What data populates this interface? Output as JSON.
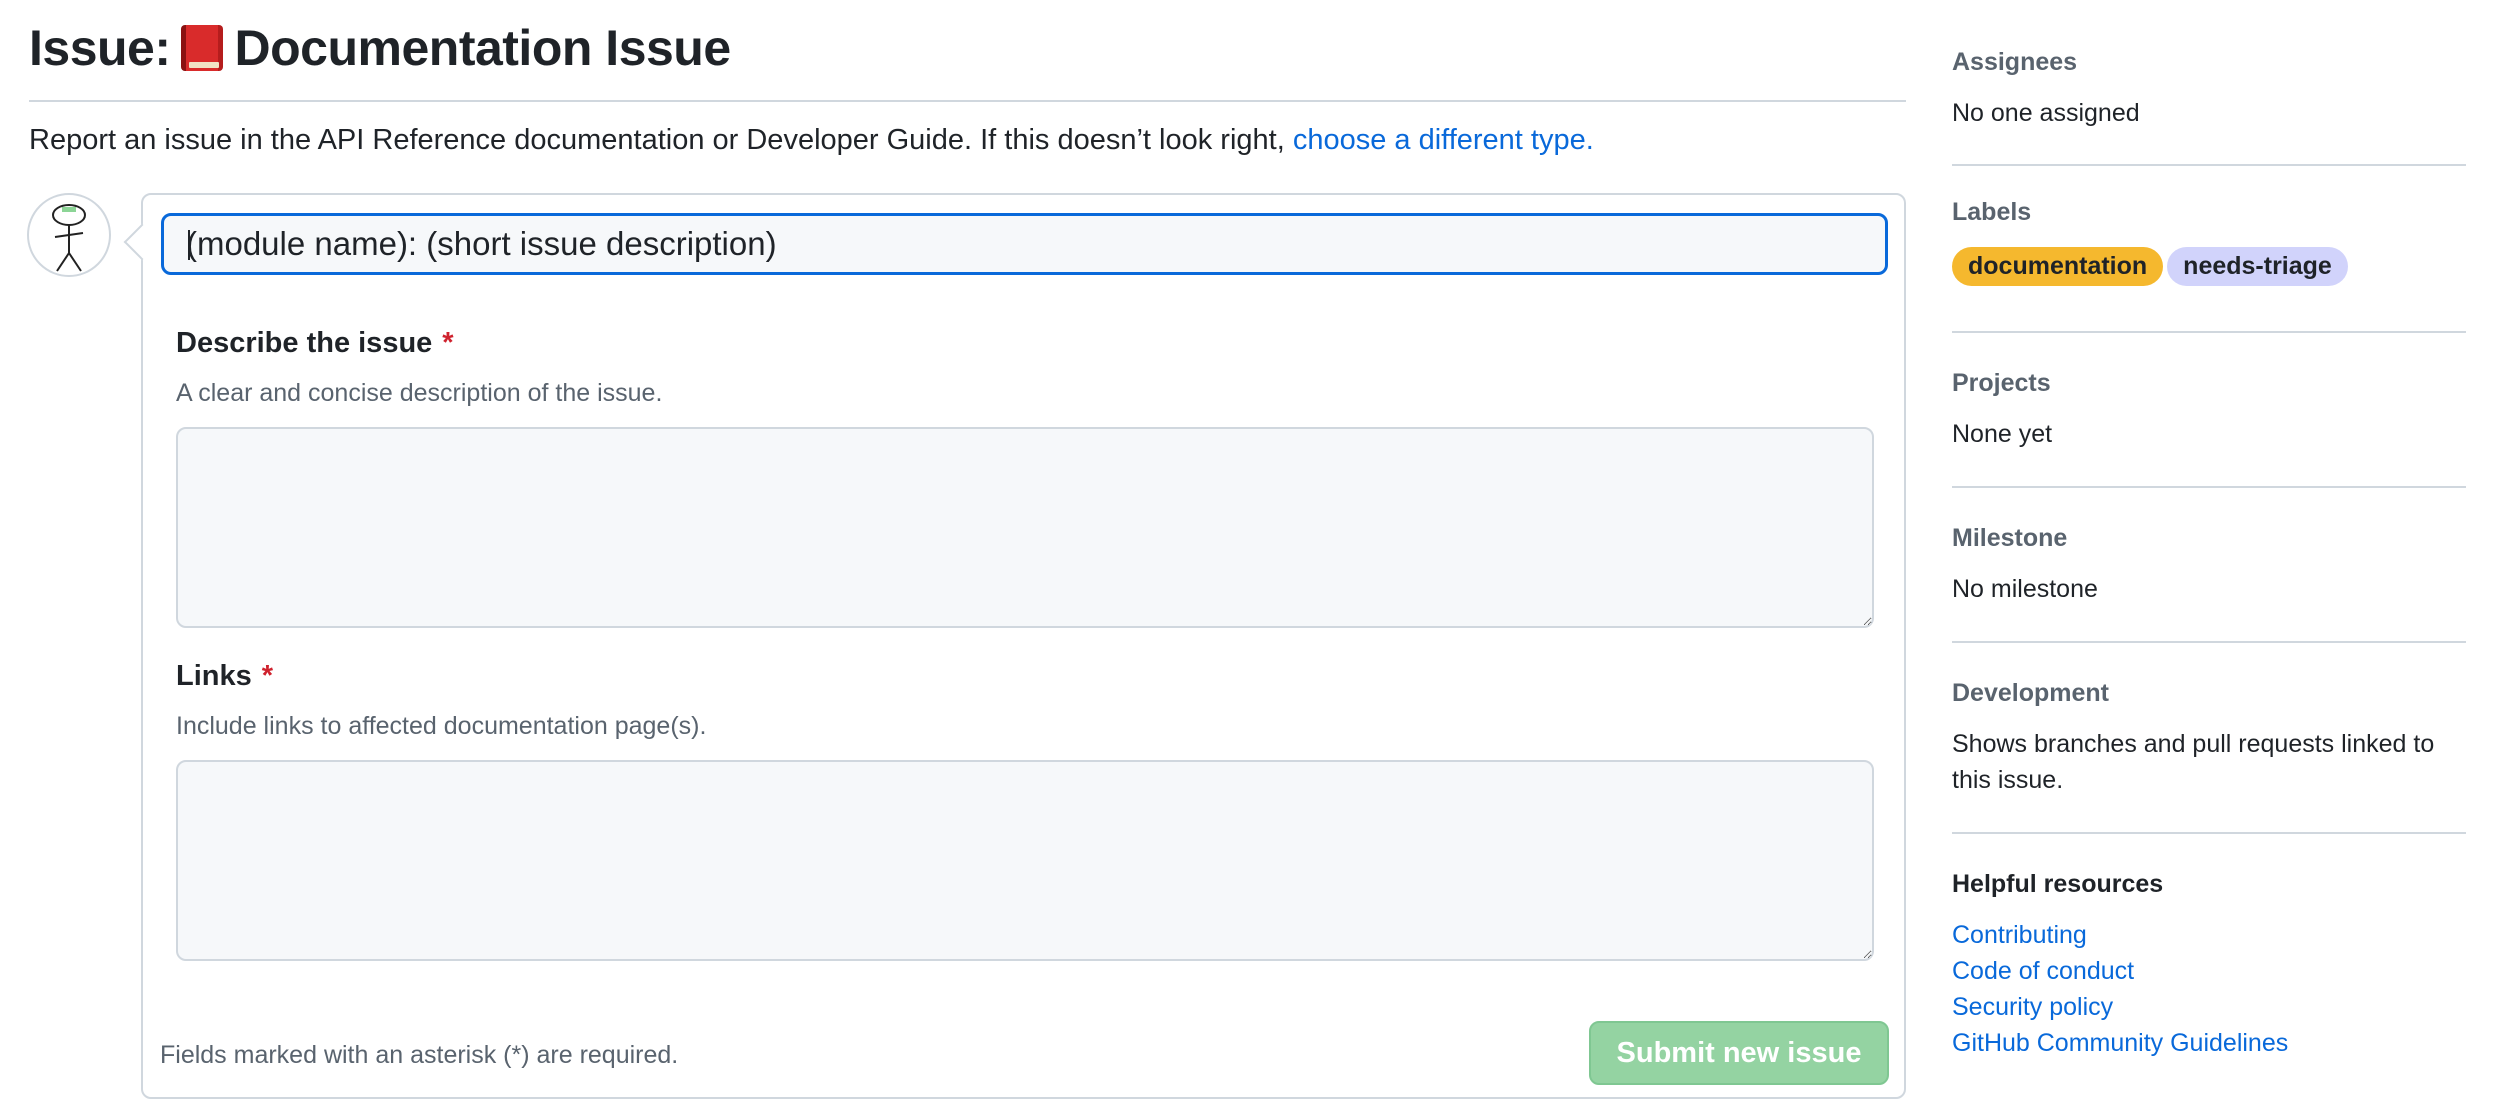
{
  "header": {
    "title_prefix": "Issue:",
    "title_text": "Documentation Issue",
    "intro_text": "Report an issue in the API Reference documentation or Developer Guide. If this doesn’t look right,",
    "intro_link": "choose a different type."
  },
  "form": {
    "title_placeholder": "(module name): (short issue description)",
    "fields": [
      {
        "label": "Describe the issue",
        "required_mark": "*",
        "description": "A clear and concise description of the issue."
      },
      {
        "label": "Links",
        "required_mark": "*",
        "description": "Include links to affected documentation page(s)."
      }
    ],
    "footer_note": "Fields marked with an asterisk (*) are required.",
    "submit_label": "Submit new issue",
    "submit_enabled": false
  },
  "sidebar": {
    "assignees": {
      "heading": "Assignees",
      "value": "No one assigned"
    },
    "labels": {
      "heading": "Labels",
      "items": [
        {
          "name": "documentation",
          "color": "#f5b82e"
        },
        {
          "name": "needs-triage",
          "color": "#d1d3fb"
        }
      ]
    },
    "projects": {
      "heading": "Projects",
      "value": "None yet"
    },
    "milestone": {
      "heading": "Milestone",
      "value": "No milestone"
    },
    "development": {
      "heading": "Development",
      "value": "Shows branches and pull requests linked to this issue."
    },
    "helpful": {
      "heading": "Helpful resources",
      "links": [
        "Contributing",
        "Code of conduct",
        "Security policy",
        "GitHub Community Guidelines"
      ]
    }
  },
  "colors": {
    "accent": "#0969da",
    "required": "#cf222e",
    "submit_disabled": "#94d3a2"
  }
}
